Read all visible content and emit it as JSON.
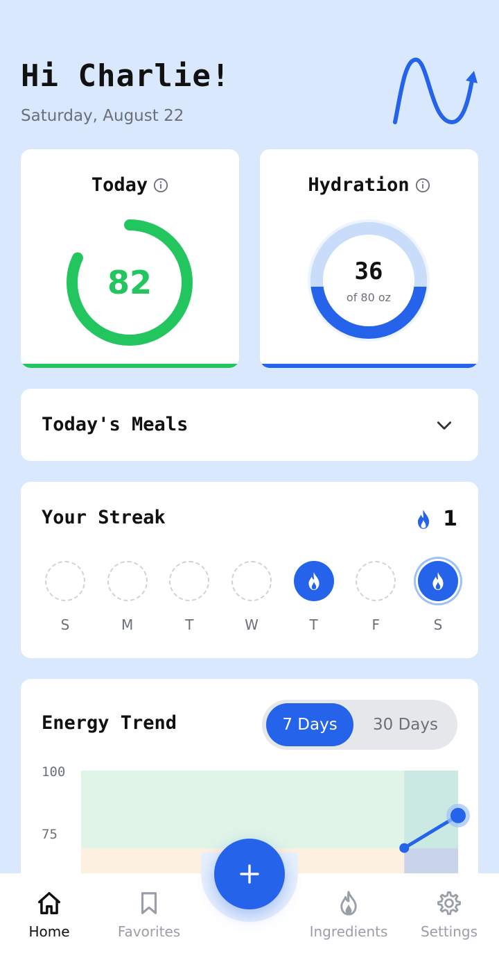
{
  "header": {
    "greeting": "Hi Charlie!",
    "date": "Saturday, August 22"
  },
  "today": {
    "title": "Today",
    "score": "82",
    "progress": 0.82,
    "color": "#22c55e"
  },
  "hydration": {
    "title": "Hydration",
    "value": "36",
    "of_label": "of 80 oz",
    "progress": 0.45,
    "color": "#2563eb"
  },
  "meals": {
    "title": "Today's Meals"
  },
  "streak": {
    "title": "Your Streak",
    "count": "1",
    "days": [
      {
        "label": "S",
        "state": "empty"
      },
      {
        "label": "M",
        "state": "empty"
      },
      {
        "label": "T",
        "state": "empty"
      },
      {
        "label": "W",
        "state": "empty"
      },
      {
        "label": "T",
        "state": "done"
      },
      {
        "label": "F",
        "state": "empty"
      },
      {
        "label": "S",
        "state": "current"
      }
    ]
  },
  "energy": {
    "title": "Energy Trend",
    "toggle": {
      "active": "7 Days",
      "inactive": "30 Days"
    }
  },
  "chart_data": {
    "type": "line",
    "ylim": [
      50,
      100
    ],
    "yticks": [
      "100",
      "75"
    ],
    "series": [
      {
        "values": [
          null,
          null,
          null,
          null,
          null,
          null,
          69,
          82
        ]
      }
    ]
  },
  "nav": {
    "items": [
      {
        "label": "Home",
        "icon": "home-icon",
        "active": true
      },
      {
        "label": "Favorites",
        "icon": "bookmark-icon",
        "active": false
      },
      {
        "label": "Ingredients",
        "icon": "flame-icon",
        "active": false
      },
      {
        "label": "Settings",
        "icon": "gear-icon",
        "active": false
      }
    ]
  },
  "colors": {
    "accent": "#2563eb",
    "green": "#22c55e",
    "background": "#d9e8fc"
  }
}
